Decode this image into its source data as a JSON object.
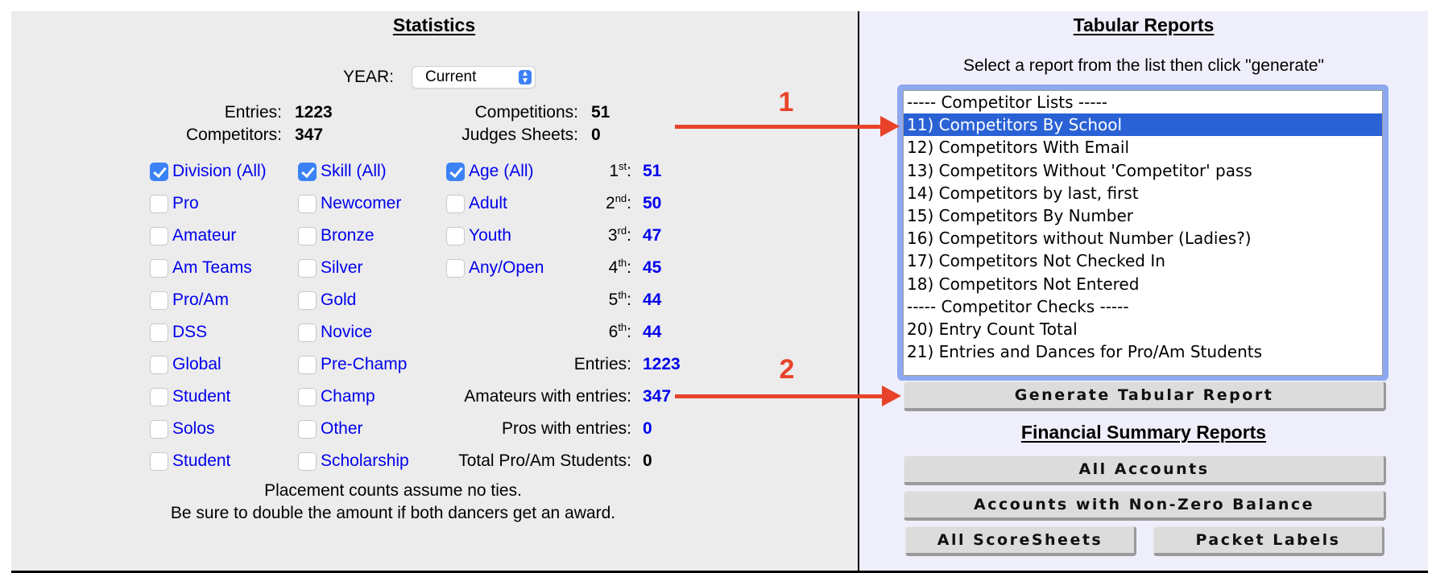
{
  "statistics": {
    "title": "Statistics",
    "year_label": "YEAR:",
    "year_value": "Current",
    "summary": {
      "entries_label": "Entries:",
      "entries_value": "1223",
      "competitors_label": "Competitors:",
      "competitors_value": "347",
      "competitions_label": "Competitions:",
      "competitions_value": "51",
      "judges_label": "Judges Sheets:",
      "judges_value": "0"
    },
    "division": [
      {
        "label": "Division (All)",
        "checked": true
      },
      {
        "label": "Pro",
        "checked": false
      },
      {
        "label": "Amateur",
        "checked": false
      },
      {
        "label": "Am Teams",
        "checked": false
      },
      {
        "label": "Pro/Am",
        "checked": false
      },
      {
        "label": "DSS",
        "checked": false
      },
      {
        "label": "Global",
        "checked": false
      },
      {
        "label": "Student",
        "checked": false
      },
      {
        "label": "Solos",
        "checked": false
      },
      {
        "label": "Student",
        "checked": false
      }
    ],
    "skill": [
      {
        "label": "Skill (All)",
        "checked": true
      },
      {
        "label": "Newcomer",
        "checked": false
      },
      {
        "label": "Bronze",
        "checked": false
      },
      {
        "label": "Silver",
        "checked": false
      },
      {
        "label": "Gold",
        "checked": false
      },
      {
        "label": "Novice",
        "checked": false
      },
      {
        "label": "Pre-Champ",
        "checked": false
      },
      {
        "label": "Champ",
        "checked": false
      },
      {
        "label": "Other",
        "checked": false
      },
      {
        "label": "Scholarship",
        "checked": false
      }
    ],
    "age": [
      {
        "label": "Age (All)",
        "checked": true
      },
      {
        "label": "Adult",
        "checked": false
      },
      {
        "label": "Youth",
        "checked": false
      },
      {
        "label": "Any/Open",
        "checked": false
      }
    ],
    "placements": [
      {
        "num": "1",
        "suffix": "st",
        "value": "51"
      },
      {
        "num": "2",
        "suffix": "nd",
        "value": "50"
      },
      {
        "num": "3",
        "suffix": "rd",
        "value": "47"
      },
      {
        "num": "4",
        "suffix": "th",
        "value": "45"
      },
      {
        "num": "5",
        "suffix": "th",
        "value": "44"
      },
      {
        "num": "6",
        "suffix": "th",
        "value": "44"
      }
    ],
    "totals": [
      {
        "label": "Entries:",
        "value": "1223",
        "link": true
      },
      {
        "label": "Amateurs with entries:",
        "value": "347",
        "link": true
      },
      {
        "label": "Pros with entries:",
        "value": "0",
        "link": true
      },
      {
        "label": "Total Pro/Am Students:",
        "value": "0",
        "link": false
      }
    ],
    "note_line1": "Placement counts assume no ties.",
    "note_line2": "Be sure to double the amount if both dancers get an award."
  },
  "tabular": {
    "title": "Tabular Reports",
    "instruction": "Select a report from the list then click \"generate\"",
    "options": [
      {
        "label": "----- Competitor Lists -----",
        "selected": false
      },
      {
        "label": "11) Competitors By School",
        "selected": true
      },
      {
        "label": "12) Competitors With Email",
        "selected": false
      },
      {
        "label": "13) Competitors Without 'Competitor' pass",
        "selected": false
      },
      {
        "label": "14) Competitors by last, first",
        "selected": false
      },
      {
        "label": "15) Competitors By Number",
        "selected": false
      },
      {
        "label": "16) Competitors without Number (Ladies?)",
        "selected": false
      },
      {
        "label": "17) Competitors Not Checked In",
        "selected": false
      },
      {
        "label": "18) Competitors Not Entered",
        "selected": false
      },
      {
        "label": "----- Competitor Checks -----",
        "selected": false
      },
      {
        "label": "20) Entry Count Total",
        "selected": false
      },
      {
        "label": "21) Entries and Dances for Pro/Am Students",
        "selected": false
      }
    ],
    "generate_label": "Generate Tabular Report"
  },
  "financial": {
    "title": "Financial Summary Reports",
    "all_accounts": "All Accounts",
    "non_zero": "Accounts with Non-Zero Balance",
    "all_scoresheets": "All ScoreSheets",
    "packet_labels": "Packet Labels"
  },
  "annotations": {
    "marker1": "1",
    "marker2": "2",
    "color": "#e8432a"
  },
  "colors": {
    "link_blue": "#0000ee",
    "selection_blue": "#2a62d6",
    "checkbox_blue": "#3b82f6"
  }
}
